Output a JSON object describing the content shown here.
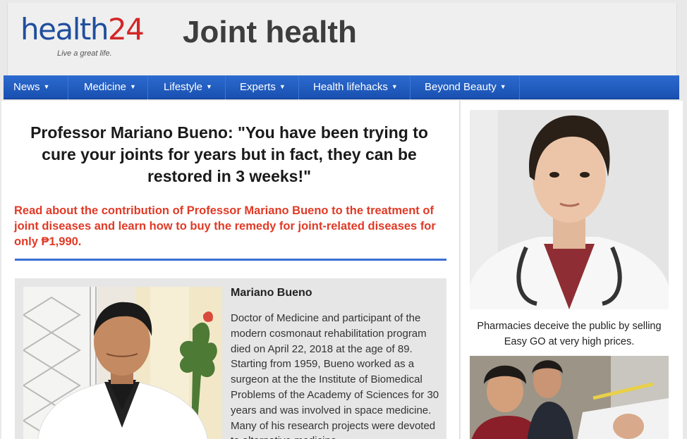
{
  "header": {
    "logo_part1": "health",
    "logo_part2": "24",
    "tagline": "Live a great life.",
    "page_heading": "Joint health"
  },
  "nav": [
    {
      "label": "News"
    },
    {
      "label": "Medicine"
    },
    {
      "label": "Lifestyle"
    },
    {
      "label": "Experts"
    },
    {
      "label": "Health lifehacks"
    },
    {
      "label": "Beyond Beauty"
    }
  ],
  "article": {
    "title": "Professor Mariano Bueno: \"You have been trying to cure your joints for years but in fact, they can be restored in 3 weeks!\"",
    "lead": "Read about the contribution of Professor Mariano Bueno to the treatment of joint diseases and learn how to buy the remedy for joint-related diseases for only ₱1,990.",
    "bio_name": "Mariano Bueno",
    "bio_text": "Doctor of Medicine and participant of the modern cosmonaut rehabilitation program died on April 22, 2018 at the age of 89. Starting from 1959, Bueno worked as a surgeon at the the Institute of Biomedical Problems of the Academy of Sciences for 30 years and was involved in space medicine. Many of his research projects were devoted to alternative medicine."
  },
  "sidebar": {
    "caption": "Pharmacies deceive the public by selling Easy GO at very high prices."
  },
  "colors": {
    "nav_blue": "#1f5cc0",
    "logo_blue": "#1f4e9e",
    "logo_red": "#d32727",
    "lead_red": "#e03a26",
    "rule_blue": "#3b6fd4"
  }
}
